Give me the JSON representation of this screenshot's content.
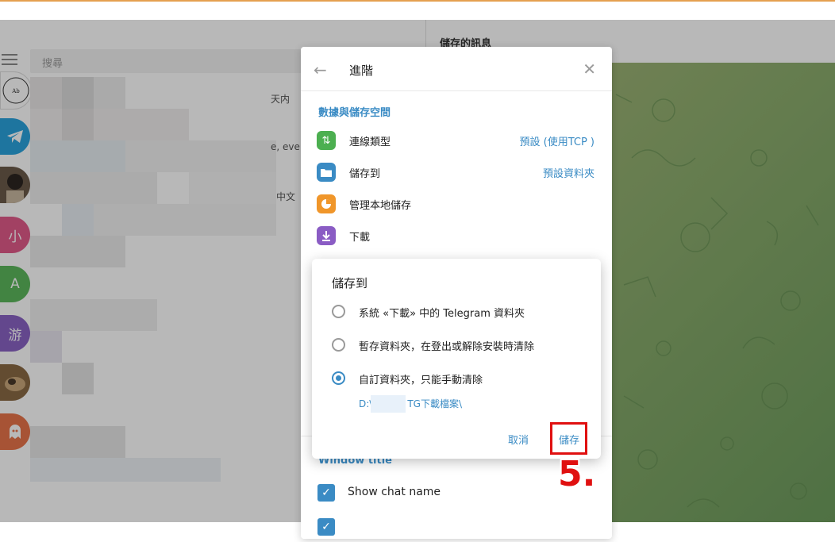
{
  "search": {
    "placeholder": "搜尋"
  },
  "chat_header": {
    "title": "儲存的訊息"
  },
  "chatlist": {
    "avatars": [
      {
        "kind": "logo",
        "color": "#ffffff",
        "text": ""
      },
      {
        "kind": "telegram",
        "color": "#2aa3dd",
        "text": ""
      },
      {
        "kind": "photo",
        "color": "#6b5a4a",
        "text": ""
      },
      {
        "kind": "letter",
        "color": "#e15a8a",
        "text": "小"
      },
      {
        "kind": "letter",
        "color": "#5cb85c",
        "text": "A"
      },
      {
        "kind": "letter",
        "color": "#8a63c4",
        "text": "游"
      },
      {
        "kind": "photo",
        "color": "#8a6a45",
        "text": ""
      },
      {
        "kind": "ghost",
        "color": "#e8734a",
        "text": ""
      }
    ],
    "snippets": [
      "天内",
      "e, eve",
      "中文"
    ]
  },
  "settings": {
    "title": "進階",
    "section_data": "數據與儲存空間",
    "rows": [
      {
        "label": "連線類型",
        "value": "預設 (使用TCP )",
        "icon": "arrows-updown-icon",
        "color": "#4caf50",
        "glyph": "⇅"
      },
      {
        "label": "儲存到",
        "value": "預設資料夾",
        "icon": "folder-icon",
        "color": "#3a8bc4",
        "glyph": "▬"
      },
      {
        "label": "管理本地儲存",
        "value": "",
        "icon": "pie-chart-icon",
        "color": "#f0962a",
        "glyph": "◔"
      },
      {
        "label": "下載",
        "value": "",
        "icon": "download-icon",
        "color": "#8a5cc4",
        "glyph": "⤓"
      }
    ],
    "section_window": "Window title",
    "show_chat_name": "Show chat name"
  },
  "dialog": {
    "title": "儲存到",
    "options": [
      {
        "label": "系統 «下載» 中的 Telegram 資料夾",
        "checked": false
      },
      {
        "label": "暫存資料夾，在登出或解除安裝時清除",
        "checked": false
      },
      {
        "label": "自訂資料夾，只能手動清除",
        "checked": true
      }
    ],
    "path_start": "D:\\",
    "path_end": "TG下載檔案\\",
    "cancel": "取消",
    "save": "儲存"
  },
  "annotation": {
    "step": "5."
  }
}
